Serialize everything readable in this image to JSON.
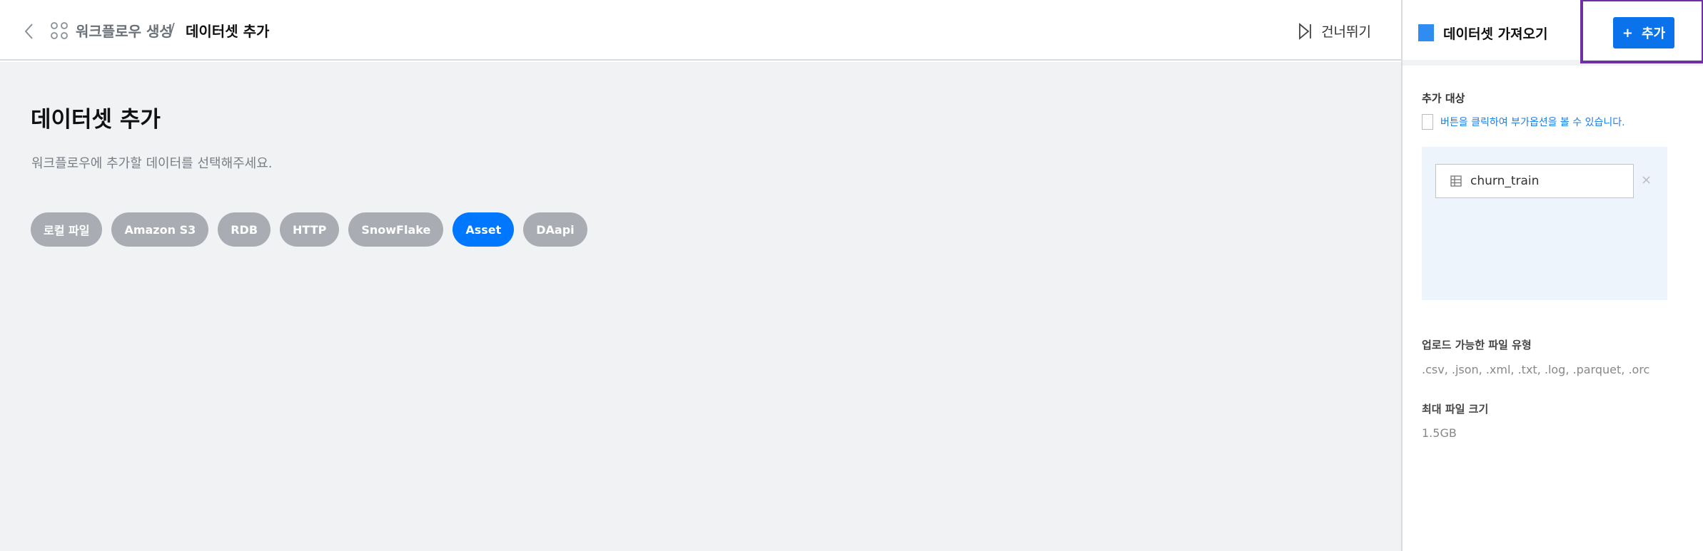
{
  "header": {
    "breadcrumb_parent": "워크플로우 생성",
    "breadcrumb_separator": "/",
    "breadcrumb_current": "데이터셋 추가",
    "skip_label": "건너뛰기"
  },
  "main": {
    "title": "데이터셋 추가",
    "subtitle": "워크플로우에 추가할 데이터를 선택해주세요.",
    "sources": [
      {
        "label": "로컬 파일",
        "active": false
      },
      {
        "label": "Amazon S3",
        "active": false
      },
      {
        "label": "RDB",
        "active": false
      },
      {
        "label": "HTTP",
        "active": false
      },
      {
        "label": "SnowFlake",
        "active": false
      },
      {
        "label": "Asset",
        "active": true
      },
      {
        "label": "DAapi",
        "active": false
      }
    ]
  },
  "panel": {
    "title": "데이터셋 가져오기",
    "add_button_icon": "+",
    "add_button_label": "추가",
    "target_label": "추가 대상",
    "hint": "버튼을 클릭하여 부가옵션을 볼 수 있습니다.",
    "target_item": "churn_train",
    "remove_icon": "×",
    "upload_types_label": "업로드 가능한 파일 유형",
    "upload_types_value": ".csv, .json, .xml, .txt, .log, .parquet, .orc",
    "max_size_label": "최대 파일 크기",
    "max_size_value": "1.5GB"
  },
  "colors": {
    "accent": "#0077ff",
    "chip_inactive": "#a9adb3",
    "highlight": "#6f2fa5",
    "panel_square": "#2f8cf0"
  }
}
